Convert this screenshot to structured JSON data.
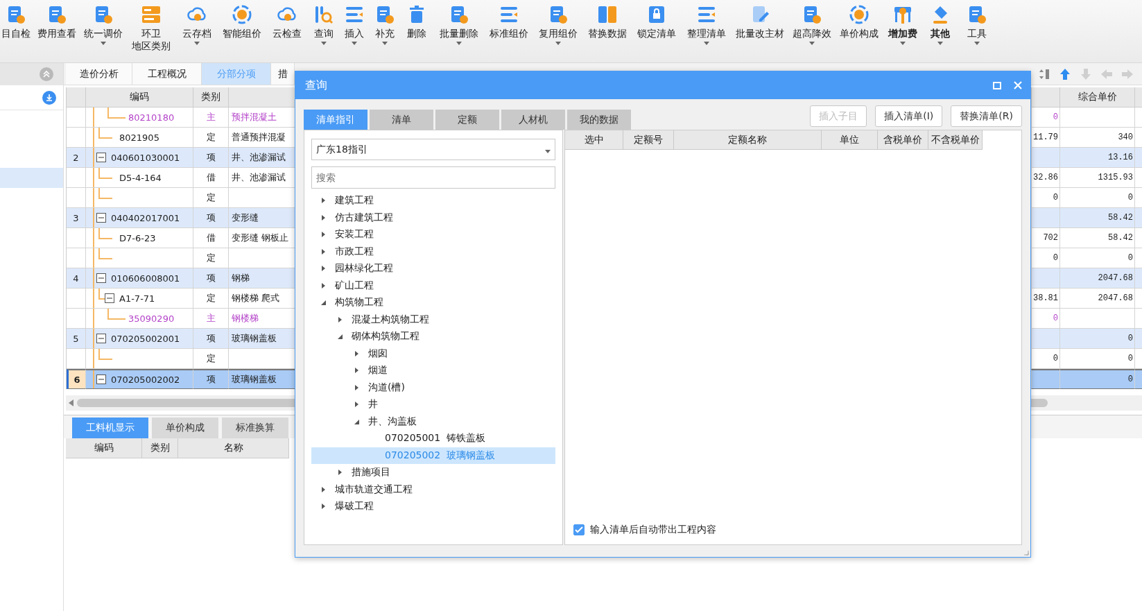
{
  "toolbar": [
    {
      "label": "目自检",
      "dropdown": false,
      "bold": false
    },
    {
      "label": "费用查看",
      "dropdown": false,
      "bold": false
    },
    {
      "label": "统一调价",
      "dropdown": true,
      "bold": false
    },
    {
      "label": "环卫",
      "sublabel": "地区类别",
      "dropdown": false,
      "bold": false
    },
    {
      "label": "云存档",
      "dropdown": true,
      "bold": false
    },
    {
      "label": "智能组价",
      "dropdown": false,
      "bold": false
    },
    {
      "label": "云检查",
      "dropdown": false,
      "bold": false
    },
    {
      "label": "查询",
      "dropdown": true,
      "bold": false
    },
    {
      "label": "插入",
      "dropdown": true,
      "bold": false
    },
    {
      "label": "补充",
      "dropdown": true,
      "bold": false
    },
    {
      "label": "删除",
      "dropdown": false,
      "bold": false
    },
    {
      "label": "批量删除",
      "dropdown": true,
      "bold": false
    },
    {
      "label": "标准组价",
      "dropdown": false,
      "bold": false
    },
    {
      "label": "复用组价",
      "dropdown": true,
      "bold": false
    },
    {
      "label": "替换数据",
      "dropdown": false,
      "bold": false
    },
    {
      "label": "锁定清单",
      "dropdown": false,
      "bold": false
    },
    {
      "label": "整理清单",
      "dropdown": true,
      "bold": false
    },
    {
      "label": "批量改主材",
      "dropdown": false,
      "bold": false
    },
    {
      "label": "超高降效",
      "dropdown": true,
      "bold": false
    },
    {
      "label": "单价构成",
      "dropdown": false,
      "bold": false
    },
    {
      "label": "增加费",
      "dropdown": true,
      "bold": true
    },
    {
      "label": "其他",
      "dropdown": true,
      "bold": true
    },
    {
      "label": "工具",
      "dropdown": true,
      "bold": false
    }
  ],
  "sidebar": {
    "rows": [
      {
        "selected": true
      }
    ]
  },
  "tabs": [
    {
      "label": "造价分析",
      "selected": false
    },
    {
      "label": "工程概况",
      "selected": false
    },
    {
      "label": "分部分项",
      "selected": true
    },
    {
      "label": "措",
      "selected": false
    }
  ],
  "nav_arrows": [
    {
      "kind": "up",
      "disabled": false
    },
    {
      "kind": "down",
      "disabled": true
    },
    {
      "kind": "left",
      "disabled": true
    },
    {
      "kind": "right",
      "disabled": true
    }
  ],
  "table": {
    "columns": [
      "编码",
      "类别",
      "综合单价"
    ],
    "rows": [
      {
        "kind": "material",
        "code": "80210180",
        "type": "主",
        "name": "预拌混凝土",
        "column_5": "0",
        "selected": false
      },
      {
        "kind": "quota",
        "code": "8021905",
        "type": "定",
        "name": "普通预拌混凝",
        "column_5": "11.79",
        "unit_price": "340",
        "selected": false
      },
      {
        "kind": "item",
        "number": "2",
        "code": "040601030001",
        "type": "项",
        "name": "井、池渗漏试",
        "unit_price": "13.16",
        "expanded": true,
        "selected": false
      },
      {
        "kind": "quota",
        "code": "D5-4-164",
        "type": "借",
        "name": "井、池渗漏试",
        "column_5": "32.86",
        "unit_price": "1315.93",
        "selected": false
      },
      {
        "kind": "quota",
        "type": "定",
        "column_5": "0",
        "unit_price": "0",
        "selected": false
      },
      {
        "kind": "item",
        "number": "3",
        "code": "040402017001",
        "type": "项",
        "name": "变形缝",
        "unit_price": "58.42",
        "expanded": true,
        "selected": false
      },
      {
        "kind": "quota",
        "code": "D7-6-23",
        "type": "借",
        "name": "变形缝 钢板止",
        "column_5": "702",
        "unit_price": "58.42",
        "selected": false
      },
      {
        "kind": "quota",
        "type": "定",
        "column_5": "0",
        "unit_price": "0",
        "selected": false
      },
      {
        "kind": "item",
        "number": "4",
        "code": "010606008001",
        "type": "项",
        "name": "钢梯",
        "unit_price": "2047.68",
        "expanded": true,
        "selected": false
      },
      {
        "kind": "quota",
        "code": "A1-7-71",
        "type": "定",
        "name": "钢楼梯 爬式",
        "column_5": "38.81",
        "unit_price": "2047.68",
        "expanded": true,
        "selected": false
      },
      {
        "kind": "material",
        "code": "35090290",
        "type": "主",
        "name": "钢楼梯",
        "column_5": "0",
        "selected": false
      },
      {
        "kind": "item",
        "number": "5",
        "code": "070205002001",
        "type": "项",
        "name": "玻璃钢盖板",
        "unit_price": "0",
        "expanded": true,
        "selected": false
      },
      {
        "kind": "quota",
        "type": "定",
        "column_5": "0",
        "unit_price": "0",
        "selected": false
      },
      {
        "kind": "item",
        "number": "6",
        "code": "070205002002",
        "type": "项",
        "name": "玻璃钢盖板",
        "unit_price": "0",
        "expanded": true,
        "selected": true
      }
    ]
  },
  "bottom_tabs": [
    {
      "label": "工料机显示",
      "selected": true
    },
    {
      "label": "单价构成",
      "selected": false
    },
    {
      "label": "标准换算",
      "selected": false
    }
  ],
  "bottom_columns": [
    "编码",
    "类别",
    "名称"
  ],
  "dialog": {
    "title": "查询",
    "tabs": [
      {
        "label": "清单指引",
        "selected": true
      },
      {
        "label": "清单",
        "selected": false
      },
      {
        "label": "定额",
        "selected": false
      },
      {
        "label": "人材机",
        "selected": false
      },
      {
        "label": "我的数据",
        "selected": false
      }
    ],
    "buttons": [
      {
        "label": "插入子目",
        "disabled": true
      },
      {
        "label": "插入清单(I)",
        "disabled": false
      },
      {
        "label": "替换清单(R)",
        "disabled": false
      }
    ],
    "library": "广东18指引",
    "search": {
      "placeholder": "搜索"
    },
    "tree": [
      {
        "label": "建筑工程",
        "expanded": false,
        "selected": false
      },
      {
        "label": "仿古建筑工程",
        "expanded": false,
        "selected": false
      },
      {
        "label": "安装工程",
        "expanded": false,
        "selected": false
      },
      {
        "label": "市政工程",
        "expanded": false,
        "selected": false
      },
      {
        "label": "园林绿化工程",
        "expanded": false,
        "selected": false
      },
      {
        "label": "矿山工程",
        "expanded": false,
        "selected": false
      },
      {
        "label": "构筑物工程",
        "expanded": true,
        "selected": false,
        "children": [
          {
            "label": "混凝土构筑物工程",
            "expanded": false,
            "selected": false
          },
          {
            "label": "砌体构筑物工程",
            "expanded": true,
            "selected": false,
            "children": [
              {
                "label": "烟囱",
                "expanded": false,
                "selected": false
              },
              {
                "label": "烟道",
                "expanded": false,
                "selected": false
              },
              {
                "label": "沟道(槽)",
                "expanded": false,
                "selected": false
              },
              {
                "label": "井",
                "expanded": false,
                "selected": false
              },
              {
                "label": "井、沟盖板",
                "expanded": true,
                "selected": false,
                "children": [
                  {
                    "label": "070205001  铸铁盖板",
                    "selected": false
                  },
                  {
                    "label": "070205002  玻璃钢盖板",
                    "selected": true
                  }
                ]
              }
            ]
          },
          {
            "label": "措施项目",
            "expanded": false,
            "selected": false
          }
        ]
      },
      {
        "label": "城市轨道交通工程",
        "expanded": false,
        "selected": false
      },
      {
        "label": "爆破工程",
        "expanded": false,
        "selected": false
      }
    ],
    "columns": [
      "选中",
      "定额号",
      "定额名称",
      "单位",
      "含税单价",
      "不含税单价"
    ],
    "auto_content": {
      "label": "输入清单后自动带出工程内容",
      "checked": true
    }
  }
}
